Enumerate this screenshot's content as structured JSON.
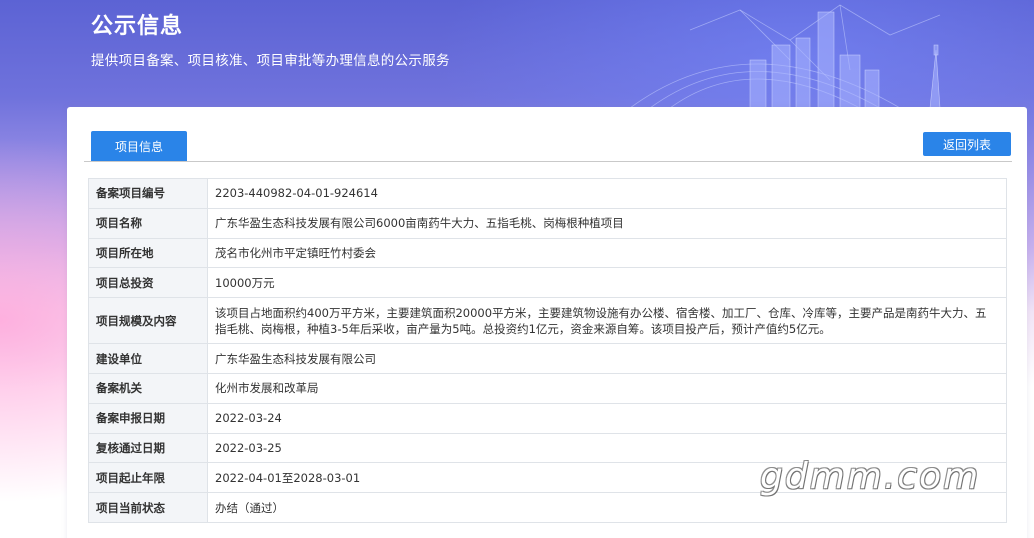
{
  "hero": {
    "title": "公示信息",
    "subtitle": "提供项目备案、项目核准、项目审批等办理信息的公示服务"
  },
  "tabs": {
    "project_info": "项目信息"
  },
  "actions": {
    "back_to_list": "返回列表"
  },
  "info": {
    "rows": [
      {
        "label": "备案项目编号",
        "value": "2203-440982-04-01-924614"
      },
      {
        "label": "项目名称",
        "value": "广东华盈生态科技发展有限公司6000亩南药牛大力、五指毛桃、岗梅根种植项目"
      },
      {
        "label": "项目所在地",
        "value": "茂名市化州市平定镇旺竹村委会"
      },
      {
        "label": "项目总投资",
        "value": "10000万元"
      },
      {
        "label": "项目规模及内容",
        "value": "该项目占地面积约400万平方米，主要建筑面积20000平方米，主要建筑物设施有办公楼、宿舍楼、加工厂、仓库、冷库等，主要产品是南药牛大力、五指毛桃、岗梅根，种植3-5年后采收，亩产量为5吨。总投资约1亿元，资金来源自筹。该项目投产后，预计产值约5亿元。"
      },
      {
        "label": "建设单位",
        "value": "广东华盈生态科技发展有限公司"
      },
      {
        "label": "备案机关",
        "value": "化州市发展和改革局"
      },
      {
        "label": "备案申报日期",
        "value": "2022-03-24"
      },
      {
        "label": "复核通过日期",
        "value": "2022-03-25"
      },
      {
        "label": "项目起止年限",
        "value": "2022-04-01至2028-03-01"
      },
      {
        "label": "项目当前状态",
        "value": "办结（通过）"
      }
    ]
  },
  "watermark": "gdmm.com",
  "colors": {
    "accent": "#2a84e8",
    "hero_top": "#5c63d4",
    "label_bg": "#f3f5f8"
  }
}
